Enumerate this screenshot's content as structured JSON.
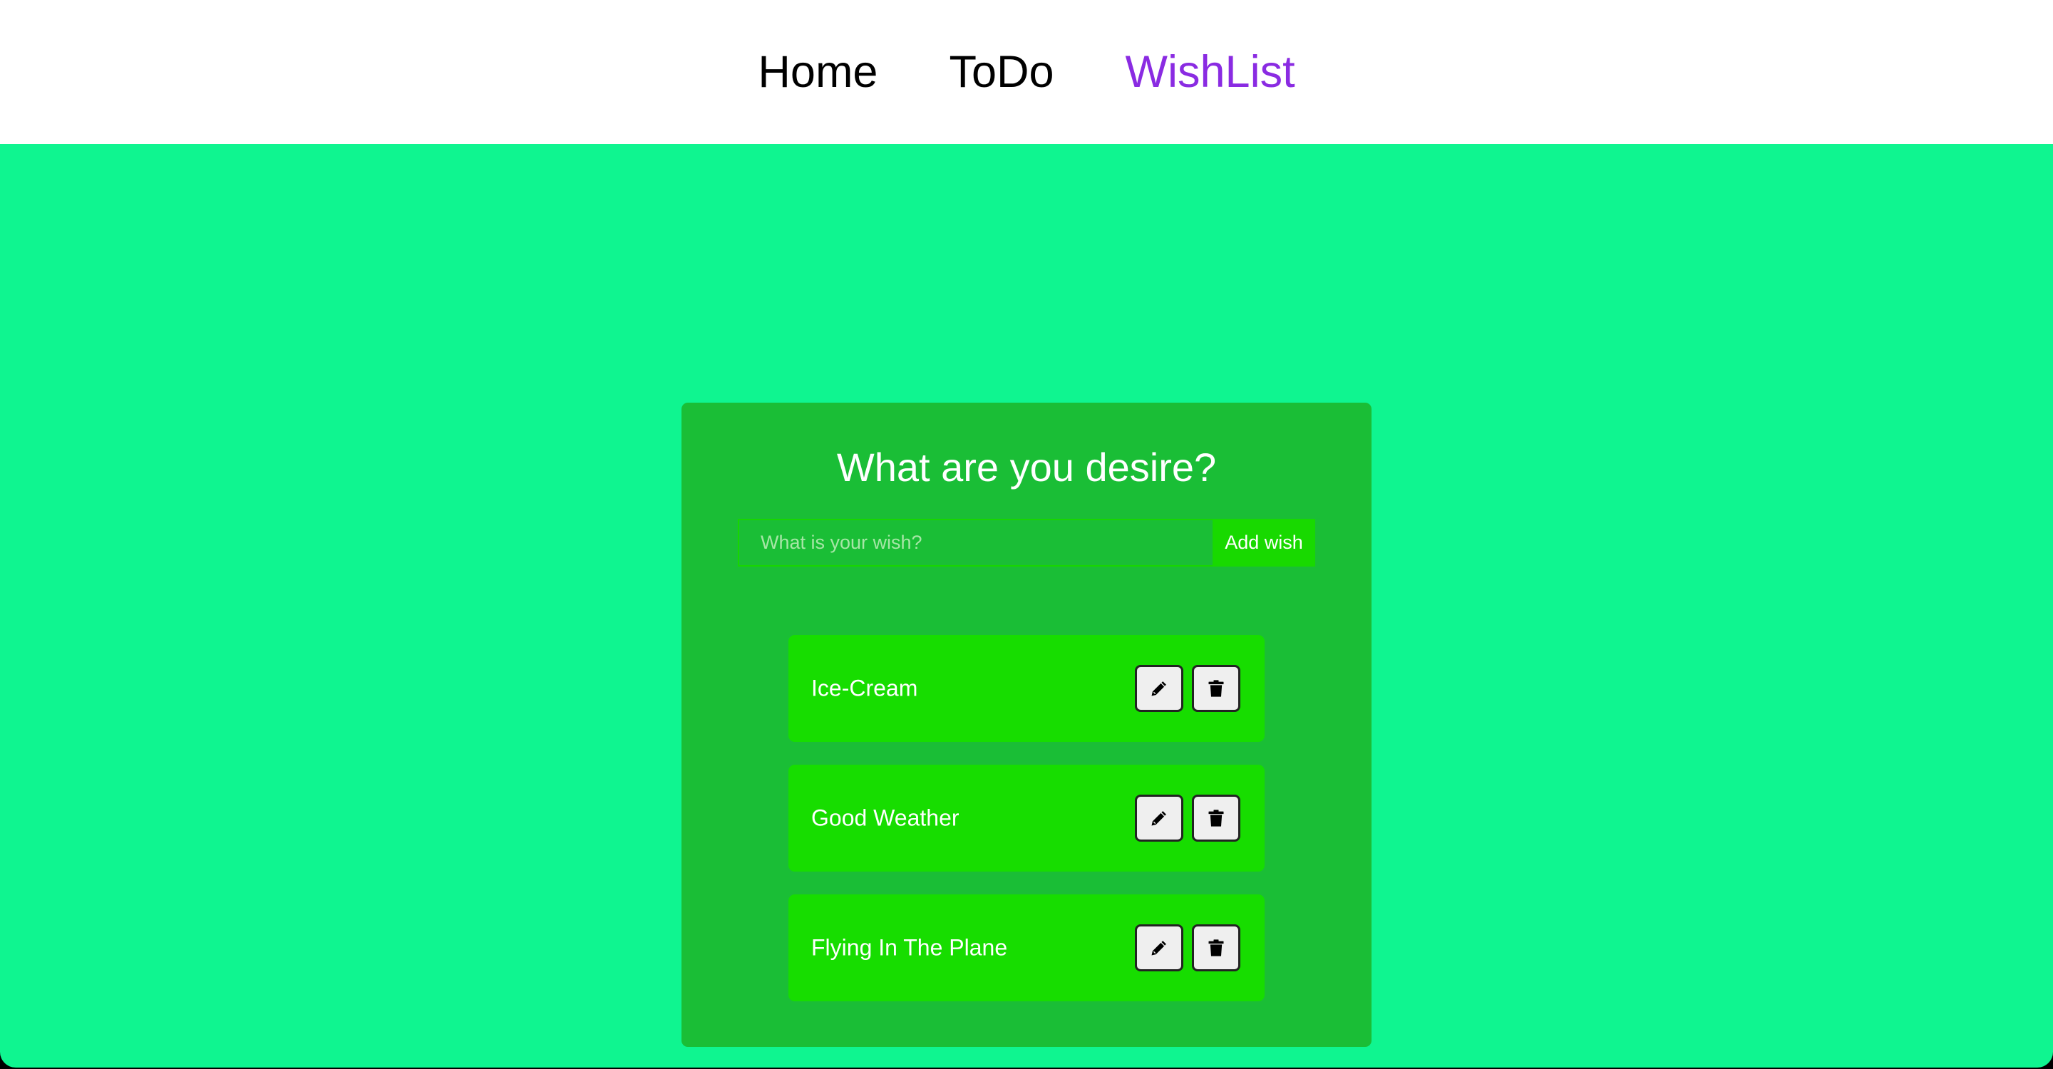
{
  "nav": {
    "items": [
      {
        "label": "Home"
      },
      {
        "label": "ToDo"
      },
      {
        "label": "WishList"
      }
    ],
    "active_index": 2,
    "active_color": "#8a2be2"
  },
  "colors": {
    "page_background": "#0ff590",
    "card_background": "#1abe36",
    "item_background": "#17dd00",
    "button_background": "#18d900"
  },
  "card": {
    "title": "What are you desire?",
    "input": {
      "placeholder": "What is your wish?",
      "value": ""
    },
    "add_button_label": "Add wish"
  },
  "wishes": [
    {
      "text": "Ice-Cream",
      "edit_icon": "pencil-icon",
      "delete_icon": "trash-icon"
    },
    {
      "text": "Good Weather",
      "edit_icon": "pencil-icon",
      "delete_icon": "trash-icon"
    },
    {
      "text": "Flying In The Plane",
      "edit_icon": "pencil-icon",
      "delete_icon": "trash-icon"
    }
  ]
}
